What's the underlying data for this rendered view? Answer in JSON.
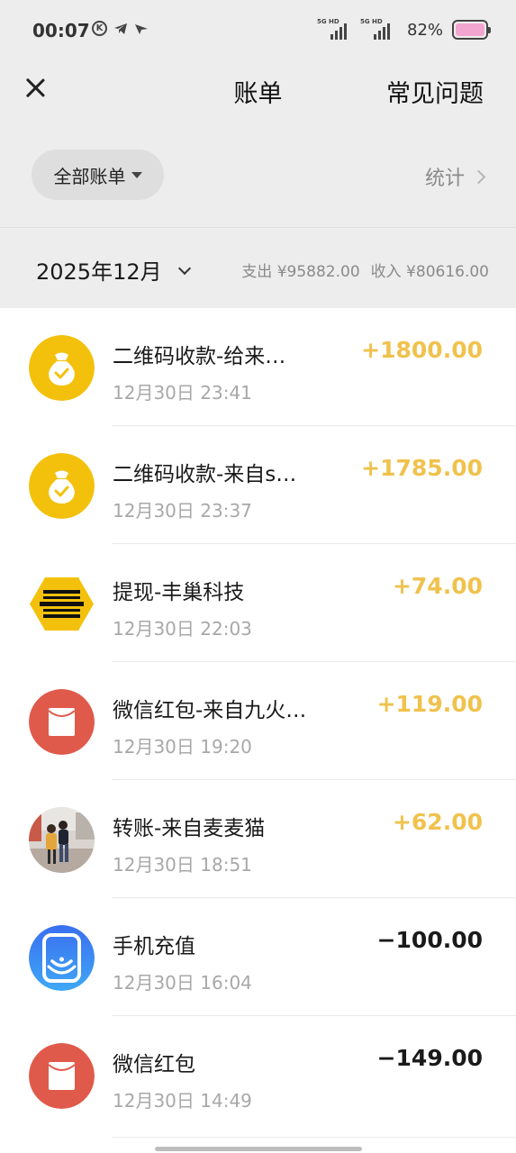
{
  "status_bar": {
    "time": "00:07",
    "icons": [
      "k-circle-icon",
      "telegram-icon",
      "location-arrow-icon"
    ],
    "sim1_label": "5G HD",
    "sim2_label": "5G HD",
    "battery_percent": "82%",
    "battery_color": "#f2a6cf"
  },
  "nav": {
    "title": "账单",
    "faq": "常见问题"
  },
  "filter": {
    "label": "全部账单",
    "stats": "统计"
  },
  "month": {
    "label": "2025年12月",
    "expense": "支出 ¥95882.00",
    "income": "收入 ¥80616.00"
  },
  "colors": {
    "income_amount": "#f0c24d",
    "expense_amount": "#1a1a1a",
    "moneybag_yellow": "#f3c10c",
    "redpacket_red": "#e05a4b",
    "phone_blue": "#2f80ed"
  },
  "transactions": [
    {
      "icon": "moneybag-icon",
      "title": "二维码收款-给来…",
      "time": "12月30日 23:41",
      "amount": "+1800.00",
      "type": "income"
    },
    {
      "icon": "moneybag-icon",
      "title": "二维码收款-来自s…",
      "time": "12月30日 23:37",
      "amount": "+1785.00",
      "type": "income"
    },
    {
      "icon": "hive-logo-icon",
      "title": "提现-丰巢科技",
      "time": "12月30日 22:03",
      "amount": "+74.00",
      "type": "income"
    },
    {
      "icon": "red-packet-icon",
      "title": "微信红包-来自九火…",
      "time": "12月30日 19:20",
      "amount": "+119.00",
      "type": "income"
    },
    {
      "icon": "user-photo-avatar",
      "title": "转账-来自麦麦猫",
      "time": "12月30日 18:51",
      "amount": "+62.00",
      "type": "income"
    },
    {
      "icon": "phone-recharge-icon",
      "title": "手机充值",
      "time": "12月30日 16:04",
      "amount": "−100.00",
      "type": "expense"
    },
    {
      "icon": "red-packet-icon",
      "title": "微信红包",
      "time": "12月30日 14:49",
      "amount": "−149.00",
      "type": "expense"
    }
  ]
}
